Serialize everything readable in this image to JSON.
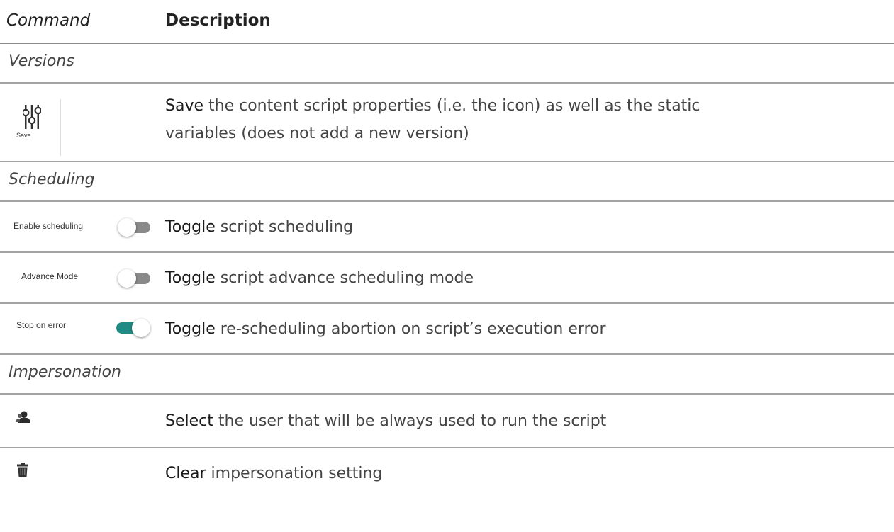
{
  "header": {
    "command_label": "Command",
    "description_label": "Description"
  },
  "sections": {
    "versions": "Versions",
    "scheduling": "Scheduling",
    "impersonation": "Impersonation"
  },
  "rows": {
    "save": {
      "button_label": "Save",
      "icon": "sliders-icon",
      "verb": "Save",
      "line1": " the content script properties (i.e. the icon) as well as the static",
      "line2": "variables (does not add a new version)"
    },
    "enable_scheduling": {
      "label": "Enable scheduling",
      "toggle_state": "off",
      "verb": "Toggle",
      "text": " script scheduling"
    },
    "advance_mode": {
      "label": "Advance Mode",
      "toggle_state": "off",
      "verb": "Toggle",
      "text": " script advance scheduling mode"
    },
    "stop_on_error": {
      "label": "Stop on error",
      "toggle_state": "on",
      "verb": "Toggle",
      "text": " re-scheduling abortion on script’s execution error"
    },
    "select_user": {
      "icon": "user-select-icon",
      "verb": "Select",
      "text": " the user that will be always used to run the script"
    },
    "clear": {
      "icon": "trash-icon",
      "verb": "Clear",
      "text": " impersonation setting"
    }
  },
  "colors": {
    "toggle_on": "#1f8b84",
    "toggle_off": "#8a8a8a",
    "border": "#a3a3a3"
  }
}
